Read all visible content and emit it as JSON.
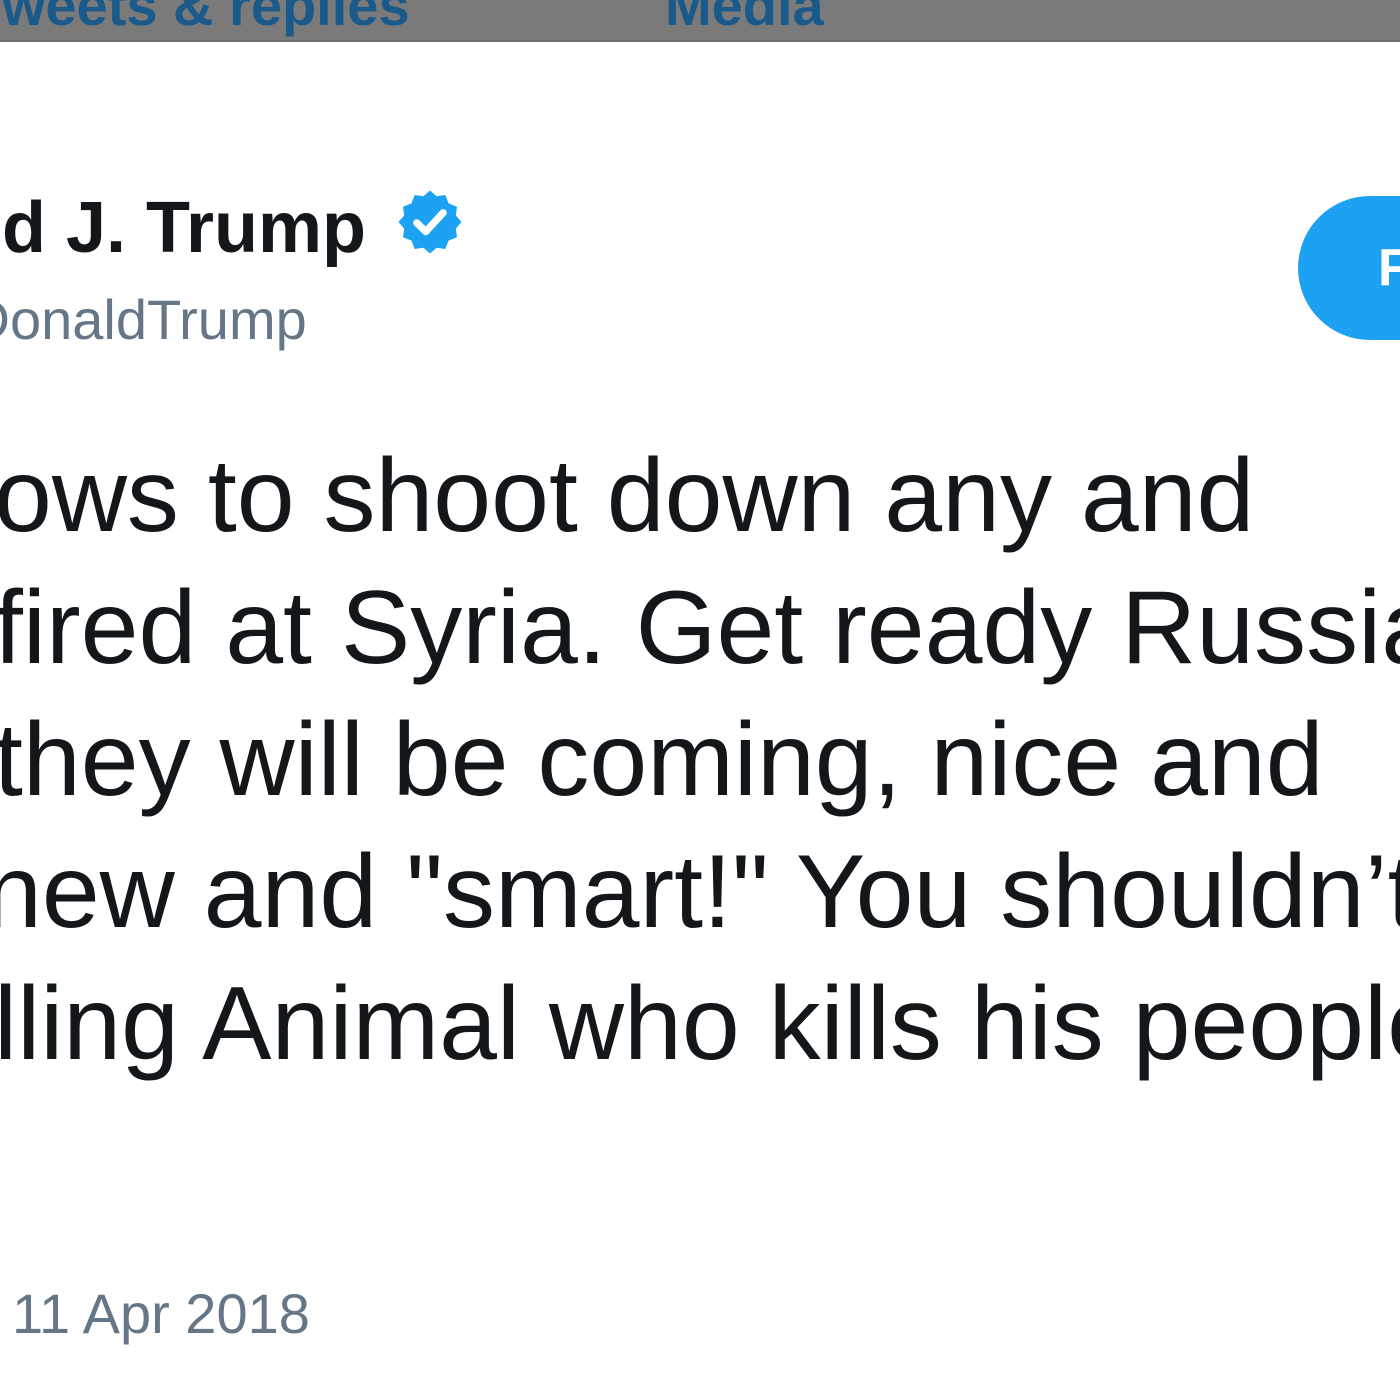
{
  "tabs": {
    "tweets_replies": "Tweets & replies",
    "media": "Media"
  },
  "author": {
    "display_name": "Donald J. Trump",
    "handle": "@realDonaldTrump",
    "verified_icon": "verified-badge-icon"
  },
  "follow_button": {
    "label": "Follow"
  },
  "tweet": {
    "lines": [
      "Russia vows to shoot down any and",
      "missiles fired at Syria. Get ready Russia,",
      "because they will be coming, nice and",
      "new and \"smart!\" You shouldn’t be partners",
      "with a Gas Killing Animal who kills his people"
    ]
  },
  "timestamp": "11 Apr 2018",
  "colors": {
    "accent": "#1da1f2",
    "text": "#14171a",
    "muted": "#657786",
    "tab_text": "#1a5a8a"
  }
}
